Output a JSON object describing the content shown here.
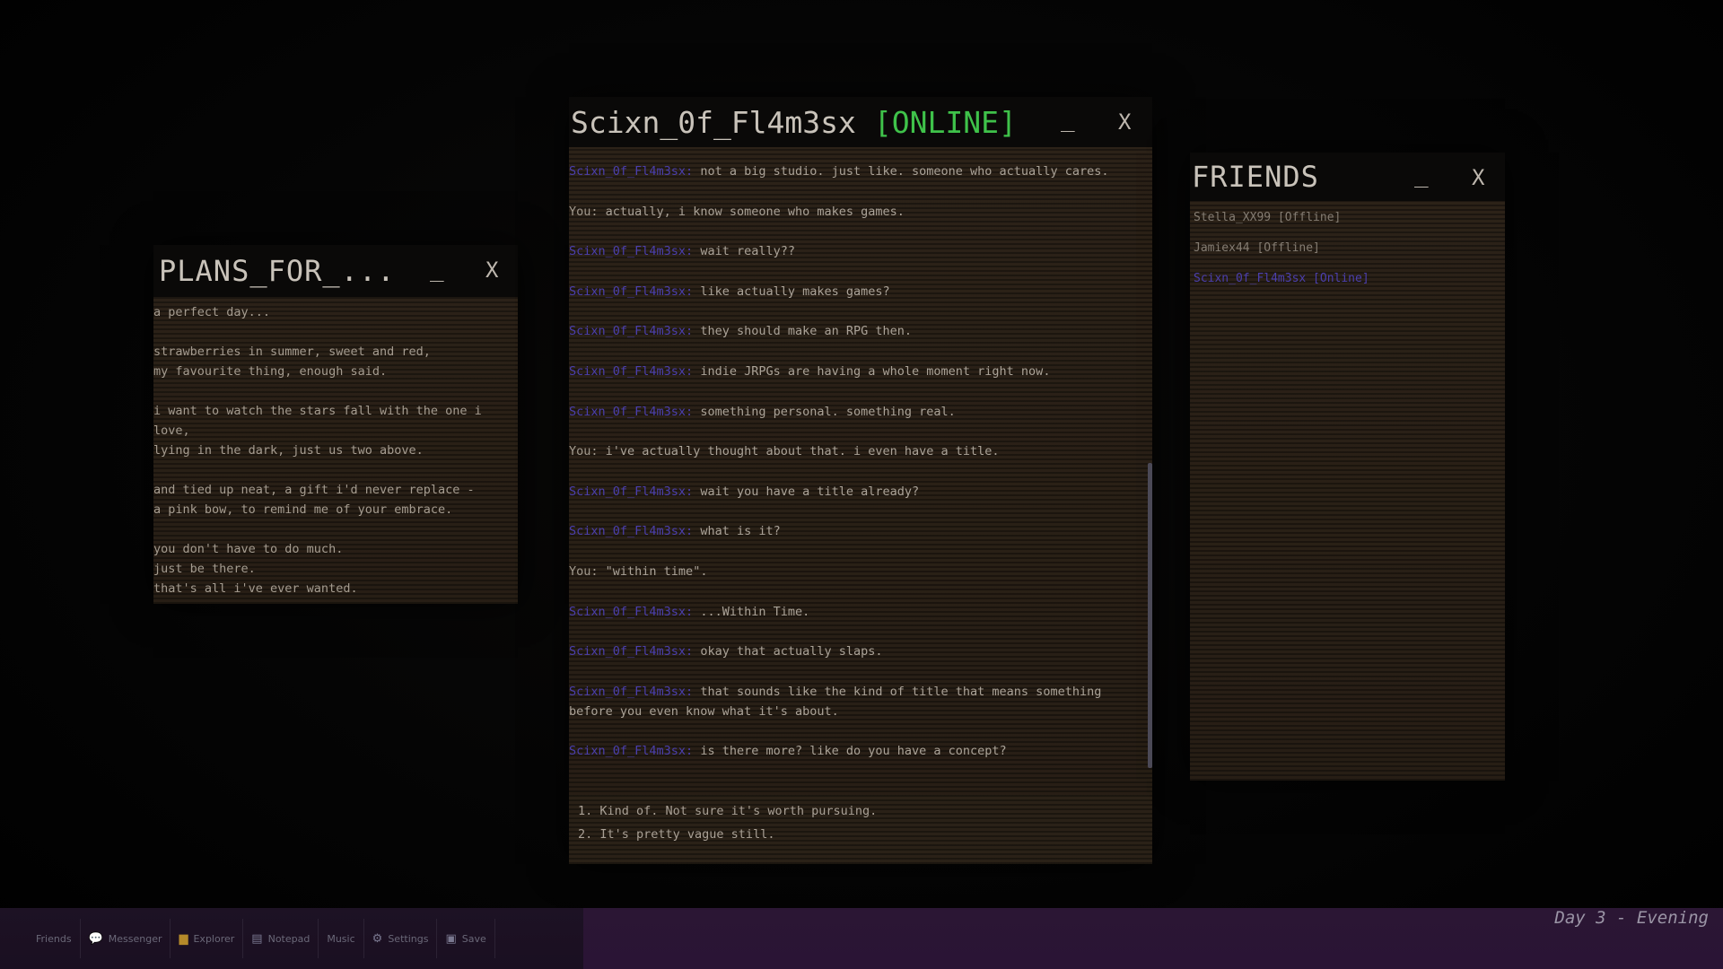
{
  "plans_window": {
    "title": "PLANS_FOR_...",
    "minimize": "_",
    "close": "X",
    "lines": [
      "a perfect day...",
      "",
      "strawberries in summer, sweet and red,",
      "my favourite thing, enough said.",
      "",
      "i want to watch the stars fall with the one i",
      "love,",
      "lying in the dark, just us two above.",
      "",
      "and tied up neat, a gift i'd never replace -",
      "a pink bow, to remind me of your embrace.",
      "",
      "you don't have to do much.",
      "just be there.",
      "that's all i've ever wanted."
    ]
  },
  "chat_window": {
    "contact": "Scixn_0f_Fl4m3sx",
    "status": "[ONLINE]",
    "minimize": "_",
    "close": "X",
    "messages": [
      {
        "sender": "Scixn_0f_Fl4m3sx:",
        "text": "not a big studio. just like. someone who actually cares."
      },
      {
        "sender": "You:",
        "text": "actually, i know someone who makes games."
      },
      {
        "sender": "Scixn_0f_Fl4m3sx:",
        "text": "wait really??"
      },
      {
        "sender": "Scixn_0f_Fl4m3sx:",
        "text": "like actually makes games?"
      },
      {
        "sender": "Scixn_0f_Fl4m3sx:",
        "text": "they should make an RPG then."
      },
      {
        "sender": "Scixn_0f_Fl4m3sx:",
        "text": "indie JRPGs are having a whole moment right now."
      },
      {
        "sender": "Scixn_0f_Fl4m3sx:",
        "text": "something personal. something real."
      },
      {
        "sender": "You:",
        "text": "i've actually thought about that. i even have a title."
      },
      {
        "sender": "Scixn_0f_Fl4m3sx:",
        "text": "wait you have a title already?"
      },
      {
        "sender": "Scixn_0f_Fl4m3sx:",
        "text": "what is it?"
      },
      {
        "sender": "You:",
        "text": "\"within time\"."
      },
      {
        "sender": "Scixn_0f_Fl4m3sx:",
        "text": "...Within Time."
      },
      {
        "sender": "Scixn_0f_Fl4m3sx:",
        "text": "okay that actually slaps."
      },
      {
        "sender": "Scixn_0f_Fl4m3sx:",
        "text": "that sounds like the kind of title that means something before you even know what it's about."
      },
      {
        "sender": "Scixn_0f_Fl4m3sx:",
        "text": "is there more? like do you have a concept?"
      }
    ],
    "choices": [
      "1. Kind of. Not sure it's worth pursuing.",
      "2. It's pretty vague still."
    ]
  },
  "friends_window": {
    "title": "FRIENDS",
    "minimize": "_",
    "close": "X",
    "friends": [
      {
        "label": "Stella_XX99 [Offline]",
        "online": false
      },
      {
        "label": "Jamiex44 [Offline]",
        "online": false
      },
      {
        "label": "Scixn_0f_Fl4m3sx [Online]",
        "online": true
      }
    ]
  },
  "taskbar": {
    "items": [
      {
        "label": "Friends",
        "icon": "friends-icon",
        "glyph": ""
      },
      {
        "label": "Messenger",
        "icon": "chat-bubble-icon",
        "glyph": "💬"
      },
      {
        "label": "Explorer",
        "icon": "folder-icon",
        "glyph": "▆"
      },
      {
        "label": "Notepad",
        "icon": "notepad-icon",
        "glyph": "▤"
      },
      {
        "label": "Music",
        "icon": "music-icon",
        "glyph": ""
      },
      {
        "label": "Settings",
        "icon": "gear-icon",
        "glyph": "⚙"
      },
      {
        "label": "Save",
        "icon": "floppy-disk-icon",
        "glyph": "▣"
      }
    ],
    "day_label": "Day 3 - Evening"
  },
  "colors": {
    "online_green": "#3fc24a",
    "npc_name_purple": "#4b3fae",
    "taskbar_purple": "#2b1634"
  }
}
